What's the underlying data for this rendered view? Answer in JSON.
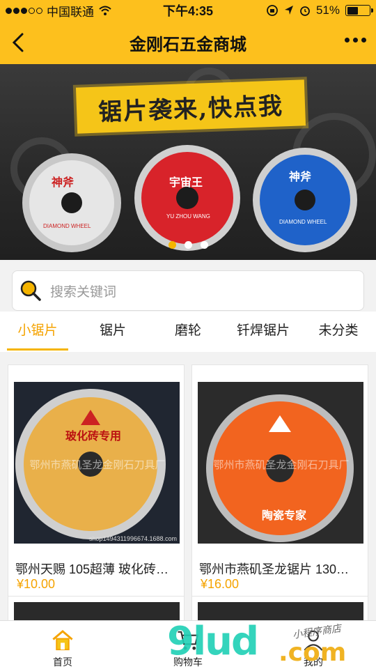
{
  "status_bar": {
    "carrier": "中国联通",
    "time": "下午4:35",
    "battery": "51%",
    "battery_level": 0.51
  },
  "nav": {
    "title": "金刚石五金商城"
  },
  "banner": {
    "slogan": "锯片袭来,快点我",
    "blades": [
      {
        "label": "神斧",
        "caption": "DIAMOND WHEEL",
        "color": "#e8e8e8"
      },
      {
        "label": "宇宙王",
        "caption": "YU ZHOU WANG",
        "color": "#d8232a"
      },
      {
        "label": "神斧",
        "caption": "DIAMOND WHEEL",
        "color": "#1f62c9"
      }
    ],
    "slide_count": 3,
    "active_slide": 1
  },
  "search": {
    "placeholder": "搜索关键词"
  },
  "tabs": [
    {
      "label": "小锯片",
      "active": true
    },
    {
      "label": "锯片",
      "active": false
    },
    {
      "label": "磨轮",
      "active": false
    },
    {
      "label": "钎焊锯片",
      "active": false
    },
    {
      "label": "未分类",
      "active": false
    }
  ],
  "products": [
    {
      "name": "鄂州天赐 105超薄 玻化砖…",
      "price": "¥10.00",
      "image_watermark": "鄂州市燕矶圣龙金刚石刀具厂",
      "image_shop": "shop1494311996674.1688.com",
      "blade_text": "玻化砖专用",
      "blade_color": "#e9b04a"
    },
    {
      "name": "鄂州市燕矶圣龙锯片 130…",
      "price": "¥16.00",
      "image_watermark": "鄂州市燕矶圣龙金刚石刀具厂",
      "blade_text": "陶瓷专家",
      "blade_color": "#f2641f"
    }
  ],
  "tabbar": [
    {
      "label": "首页",
      "icon": "home-icon"
    },
    {
      "label": "购物车",
      "icon": "cart-icon"
    },
    {
      "label": "我的",
      "icon": "user-icon"
    }
  ],
  "watermark": {
    "logo": "9lud",
    "suffix": ".com",
    "signature": "小程序商店"
  },
  "colors": {
    "brand_yellow": "#fdc01d",
    "accent_orange": "#f5a300"
  }
}
